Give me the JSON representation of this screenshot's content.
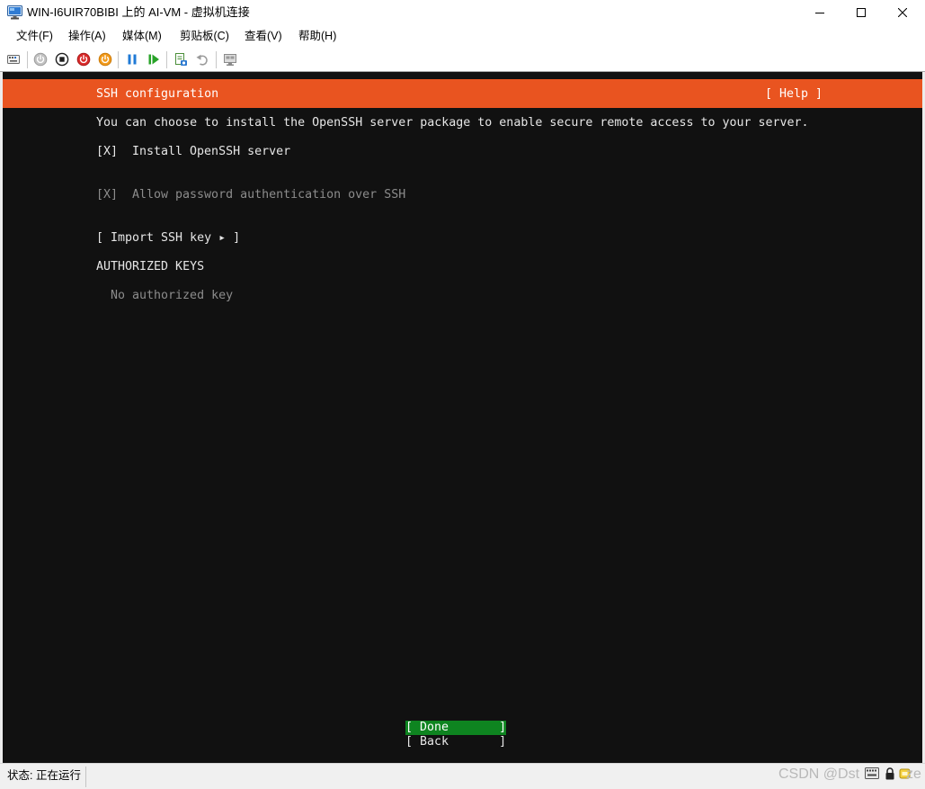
{
  "window": {
    "title": "WIN-I6UIR70BIBI 上的 AI-VM - 虚拟机连接",
    "app_icon": "vm-connection-icon",
    "controls": [
      "minimize-icon",
      "maximize-icon",
      "close-icon"
    ]
  },
  "menu": {
    "items": [
      {
        "label": "文件(F)"
      },
      {
        "label": "操作(A)"
      },
      {
        "label": "媒体(M)"
      },
      {
        "label": "剪贴板(C)"
      },
      {
        "label": "查看(V)"
      },
      {
        "label": "帮助(H)"
      }
    ]
  },
  "toolbar": {
    "buttons": [
      {
        "icon": "ctrl-alt-del-icon",
        "enabled": true
      },
      {
        "icon": "start-icon",
        "enabled": false
      },
      {
        "icon": "turn-off-icon",
        "enabled": true
      },
      {
        "icon": "shut-down-icon",
        "enabled": true
      },
      {
        "icon": "save-icon",
        "enabled": true
      },
      {
        "icon": "pause-icon",
        "enabled": true
      },
      {
        "icon": "resume-icon",
        "enabled": true
      },
      {
        "icon": "checkpoint-icon",
        "enabled": true
      },
      {
        "icon": "revert-icon",
        "enabled": false
      },
      {
        "icon": "enhanced-session-icon",
        "enabled": false
      }
    ]
  },
  "vm": {
    "header": {
      "title": "SSH configuration",
      "help": "[ Help ]"
    },
    "intro": "You can choose to install the OpenSSH server package to enable secure remote access to your server.",
    "install_openssh": {
      "box": "[X]",
      "label": "Install OpenSSH server",
      "checked": true
    },
    "allow_password": {
      "box": "[X]",
      "label": "Allow password authentication over SSH",
      "checked": true,
      "enabled": false
    },
    "import_key": "[ Import SSH key ▸ ]",
    "authorized_keys": {
      "heading": "AUTHORIZED KEYS",
      "empty_message": "No authorized key"
    },
    "buttons": {
      "done": "[ Done       ]",
      "back": "[ Back       ]",
      "done_focused": true
    }
  },
  "status": {
    "text": "状态: 正在运行",
    "icons": [
      "keyboard-icon",
      "lock-icon",
      "capture-icon"
    ]
  },
  "watermark": {
    "left": "CSDN @Dst",
    "right": "ze"
  },
  "colors": {
    "accent": "#e95420",
    "focus": "#0e8420",
    "terminal_bg": "#111111",
    "terminal_fg": "#e6e6e6",
    "dim": "#8c8c8c"
  }
}
